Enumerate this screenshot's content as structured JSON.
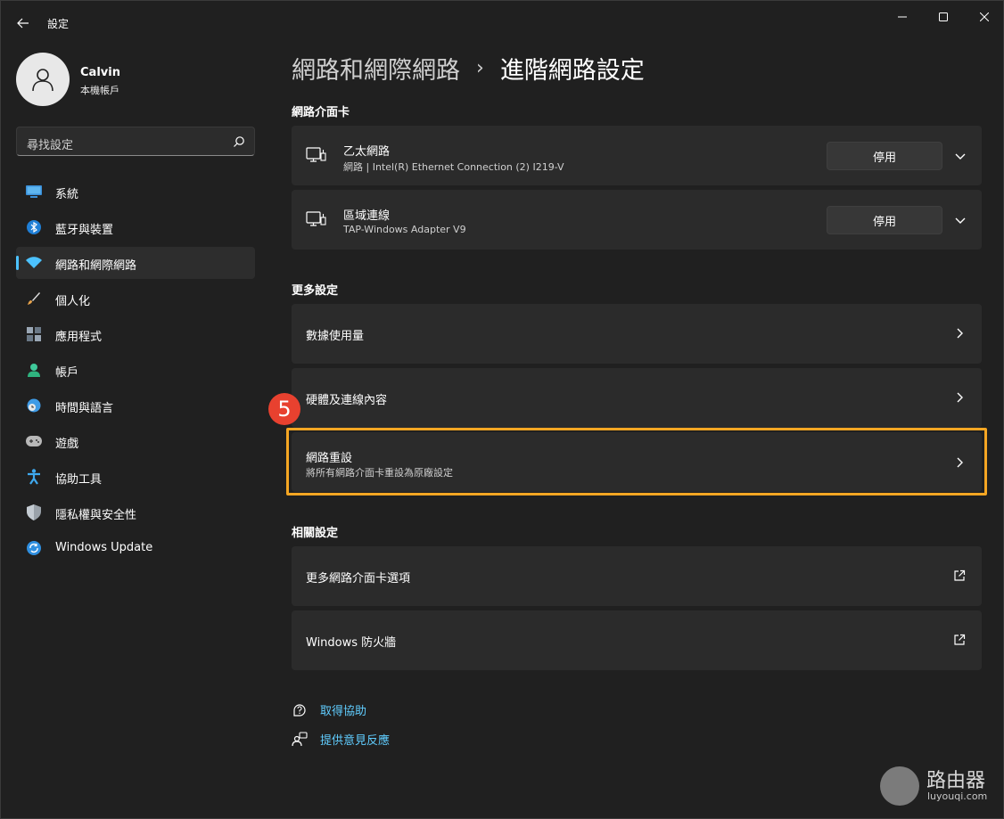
{
  "window": {
    "title": "設定"
  },
  "profile": {
    "name": "Calvin",
    "account_type": "本機帳戶"
  },
  "search": {
    "placeholder": "尋找設定"
  },
  "sidebar": {
    "items": [
      {
        "label": "系統",
        "icon": "system-icon",
        "active": false
      },
      {
        "label": "藍牙與裝置",
        "icon": "bluetooth-icon",
        "active": false
      },
      {
        "label": "網路和網際網路",
        "icon": "wifi-icon",
        "active": true
      },
      {
        "label": "個人化",
        "icon": "brush-icon",
        "active": false
      },
      {
        "label": "應用程式",
        "icon": "apps-icon",
        "active": false
      },
      {
        "label": "帳戶",
        "icon": "account-icon",
        "active": false
      },
      {
        "label": "時間與語言",
        "icon": "time-language-icon",
        "active": false
      },
      {
        "label": "遊戲",
        "icon": "gamepad-icon",
        "active": false
      },
      {
        "label": "協助工具",
        "icon": "accessibility-icon",
        "active": false
      },
      {
        "label": "隱私權與安全性",
        "icon": "shield-icon",
        "active": false
      },
      {
        "label": "Windows Update",
        "icon": "update-icon",
        "active": false
      }
    ]
  },
  "breadcrumb": {
    "parent": "網路和網際網路",
    "separator": "›",
    "current": "進階網路設定"
  },
  "adapters": {
    "section_title": "網路介面卡",
    "items": [
      {
        "name": "乙太網路",
        "detail": "網路 | Intel(R) Ethernet Connection (2) I219-V",
        "button": "停用"
      },
      {
        "name": "區域連線",
        "detail": "TAP-Windows Adapter V9",
        "button": "停用"
      }
    ]
  },
  "more_settings": {
    "section_title": "更多設定",
    "items": [
      {
        "title": "數據使用量"
      },
      {
        "title": "硬體及連線內容"
      },
      {
        "title": "網路重設",
        "subtitle": "將所有網路介面卡重設為原廠設定"
      }
    ]
  },
  "related_settings": {
    "section_title": "相關設定",
    "items": [
      {
        "title": "更多網路介面卡選項"
      },
      {
        "title": "Windows 防火牆"
      }
    ]
  },
  "help": {
    "get_help": "取得協助",
    "feedback": "提供意見反應"
  },
  "annotation": {
    "step": "5"
  },
  "watermark": {
    "text": "路由器",
    "url": "luyouqi.com"
  },
  "colors": {
    "accent": "#4cc2ff",
    "link": "#60cdff",
    "highlight": "#f5a623",
    "badge": "#e8412f"
  }
}
